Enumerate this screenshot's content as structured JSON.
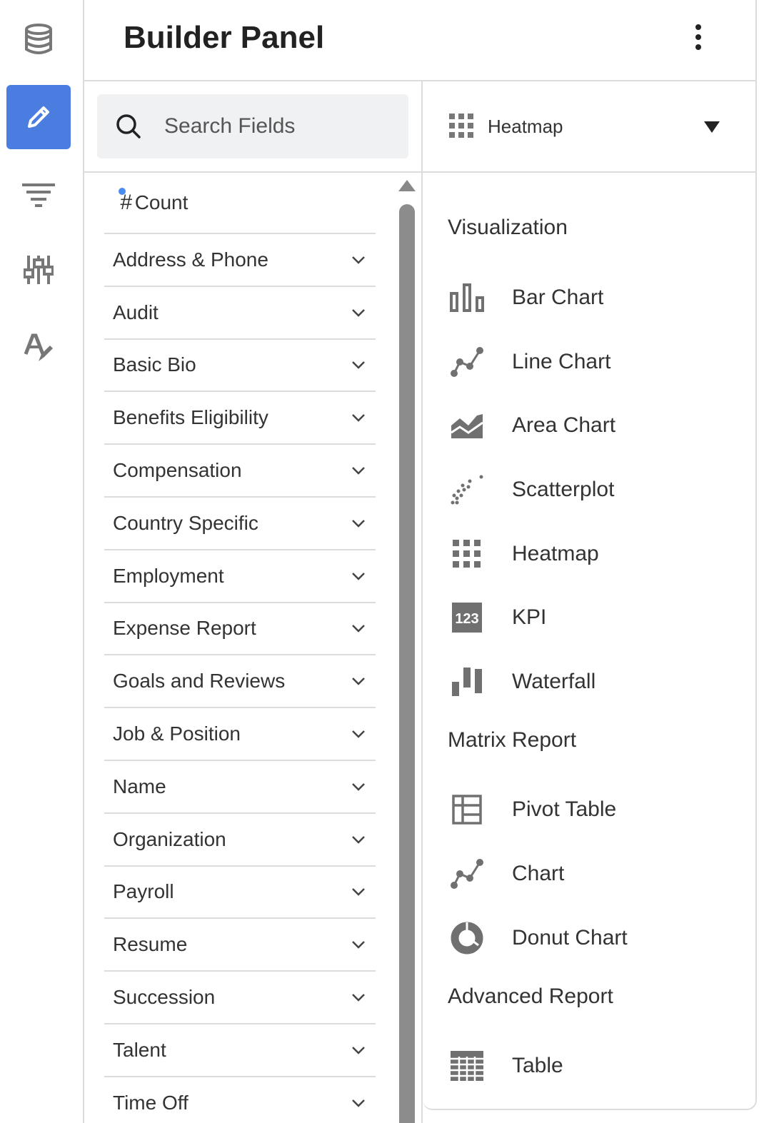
{
  "header": {
    "title": "Builder Panel"
  },
  "rail": {
    "items": [
      {
        "icon": "database-icon",
        "active": false
      },
      {
        "icon": "pencil-icon",
        "active": true
      },
      {
        "icon": "filter-icon",
        "active": false
      },
      {
        "icon": "sliders-icon",
        "active": false
      },
      {
        "icon": "text-format-icon",
        "active": false
      }
    ]
  },
  "search": {
    "placeholder": "Search Fields"
  },
  "fields": {
    "count_label": "Count",
    "count_symbol": "#",
    "groups": [
      "Address & Phone",
      "Audit",
      "Basic Bio",
      "Benefits Eligibility",
      "Compensation",
      "Country Specific",
      "Employment",
      "Expense Report",
      "Goals and Reviews",
      "Job & Position",
      "Name",
      "Organization",
      "Payroll",
      "Resume",
      "Succession",
      "Talent",
      "Time Off"
    ]
  },
  "chart_selector": {
    "selected": "Heatmap",
    "icon": "heatmap-icon"
  },
  "visualization": {
    "sections": [
      {
        "title": "Visualization",
        "items": [
          {
            "label": "Bar Chart",
            "icon": "bar-chart-icon"
          },
          {
            "label": "Line Chart",
            "icon": "line-chart-icon"
          },
          {
            "label": "Area Chart",
            "icon": "area-chart-icon"
          },
          {
            "label": "Scatterplot",
            "icon": "scatterplot-icon"
          },
          {
            "label": "Heatmap",
            "icon": "heatmap-icon"
          },
          {
            "label": "KPI",
            "icon": "kpi-icon",
            "badge": "123"
          },
          {
            "label": "Waterfall",
            "icon": "waterfall-icon"
          }
        ]
      },
      {
        "title": "Matrix Report",
        "items": [
          {
            "label": "Pivot Table",
            "icon": "pivot-table-icon"
          },
          {
            "label": "Chart",
            "icon": "line-chart-icon"
          },
          {
            "label": "Donut Chart",
            "icon": "donut-chart-icon"
          }
        ]
      },
      {
        "title": "Advanced Report",
        "items": [
          {
            "label": "Table",
            "icon": "table-icon"
          }
        ]
      }
    ]
  },
  "colors": {
    "accent": "#4a7ddf",
    "icon_gray": "#707070",
    "dot_blue": "#4a8cf0"
  }
}
